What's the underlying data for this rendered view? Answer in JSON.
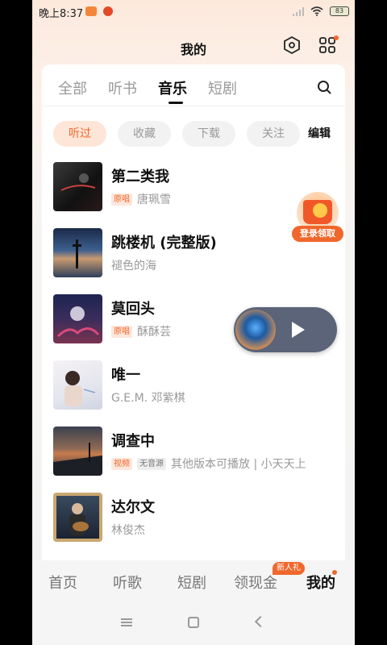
{
  "status_bar": {
    "time": "晚上8:37",
    "battery": "83"
  },
  "header": {
    "title": "我的"
  },
  "tabs": [
    {
      "label": "全部"
    },
    {
      "label": "听书"
    },
    {
      "label": "音乐"
    },
    {
      "label": "短剧"
    }
  ],
  "active_tab": "音乐",
  "chips": [
    {
      "label": "听过"
    },
    {
      "label": "收藏"
    },
    {
      "label": "下载"
    },
    {
      "label": "关注"
    }
  ],
  "edit_label": "编辑",
  "songs": [
    {
      "title": "第二类我",
      "tags": [
        "原唱"
      ],
      "subtitle": "唐珮雪"
    },
    {
      "title": "跳楼机 (完整版)",
      "tags": [],
      "subtitle": "褪色的海"
    },
    {
      "title": "莫回头",
      "tags": [
        "原唱"
      ],
      "subtitle": "酥酥芸"
    },
    {
      "title": "唯一",
      "tags": [],
      "subtitle": "G.E.M. 邓紫棋"
    },
    {
      "title": "调查中",
      "tags": [
        "视频",
        "无音源"
      ],
      "subtitle": "其他版本可播放 | 小天天上"
    },
    {
      "title": "达尔文",
      "tags": [],
      "subtitle": "林俊杰"
    }
  ],
  "promo": {
    "label": "登录领取"
  },
  "bottom_nav": [
    {
      "label": "首页"
    },
    {
      "label": "听歌"
    },
    {
      "label": "短剧"
    },
    {
      "label": "领现金"
    },
    {
      "label": "我的"
    }
  ],
  "bottom_nav_badge": "新人礼",
  "colors": {
    "accent": "#f0672c",
    "player_bg": "#5b6478"
  }
}
